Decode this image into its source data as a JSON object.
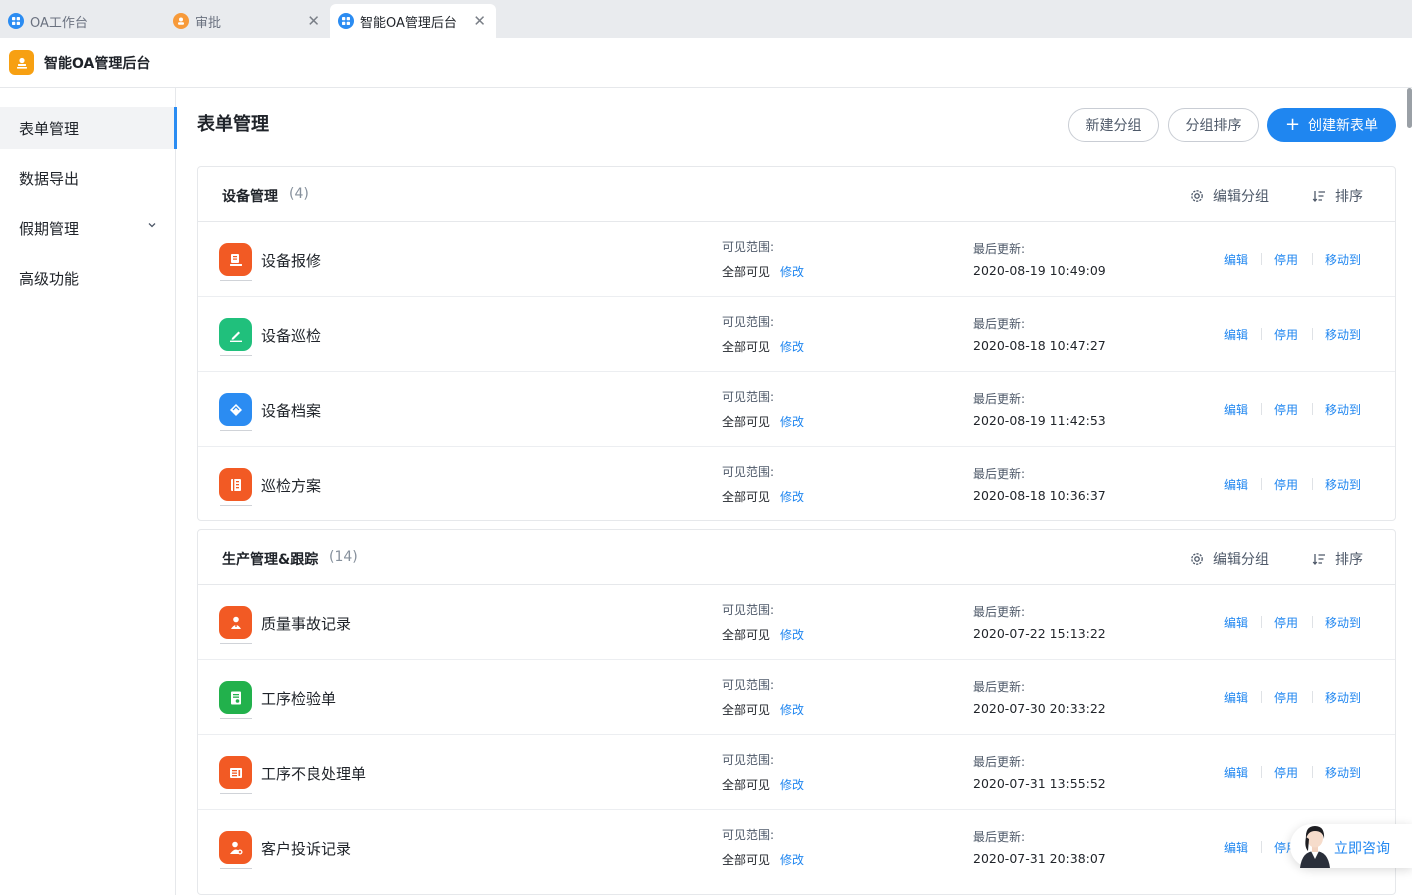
{
  "tabs": [
    {
      "label": "OA工作台",
      "icon": "apps-icon",
      "color": "#2b8cf2",
      "active": false,
      "closable": false
    },
    {
      "label": "审批",
      "icon": "user-icon",
      "color": "#f79a3a",
      "active": false,
      "closable": true
    },
    {
      "label": "智能OA管理后台",
      "icon": "apps-icon",
      "color": "#2b8cf2",
      "active": true,
      "closable": true
    }
  ],
  "tab_close_glyph": "✕",
  "app": {
    "title": "智能OA管理后台",
    "logo_color": "#f7a012"
  },
  "sidebar": {
    "items": [
      {
        "label": "表单管理",
        "active": true
      },
      {
        "label": "数据导出",
        "active": false
      },
      {
        "label": "假期管理",
        "active": false,
        "expandable": true
      },
      {
        "label": "高级功能",
        "active": false
      }
    ]
  },
  "page": {
    "title": "表单管理",
    "new_group_label": "新建分组",
    "sort_group_label": "分组排序",
    "create_form_plus": "+",
    "create_form_label": "创建新表单"
  },
  "labels": {
    "visible_range": "可见范围:",
    "last_updated": "最后更新:",
    "modify": "修改",
    "edit": "编辑",
    "disable": "停用",
    "move_to": "移动到",
    "edit_group": "编辑分组",
    "sort": "排序"
  },
  "groups": [
    {
      "name": "设备管理",
      "count": "(4)",
      "forms": [
        {
          "name": "设备报修",
          "visibility": "全部可见",
          "updated": "2020-08-19 10:49:09",
          "icon": "repair-icon",
          "color": "#f25a24"
        },
        {
          "name": "设备巡检",
          "visibility": "全部可见",
          "updated": "2020-08-18 10:47:27",
          "icon": "pen-icon",
          "color": "#20c07c"
        },
        {
          "name": "设备档案",
          "visibility": "全部可见",
          "updated": "2020-08-19 11:42:53",
          "icon": "archive-icon",
          "color": "#2b8cf2"
        },
        {
          "name": "巡检方案",
          "visibility": "全部可见",
          "updated": "2020-08-18 10:36:37",
          "icon": "plan-icon",
          "color": "#f25a24"
        }
      ]
    },
    {
      "name": "生产管理&跟踪",
      "count": "(14)",
      "forms": [
        {
          "name": "质量事故记录",
          "visibility": "全部可见",
          "updated": "2020-07-22 15:13:22",
          "icon": "person-alert-icon",
          "color": "#f25a24"
        },
        {
          "name": "工序检验单",
          "visibility": "全部可见",
          "updated": "2020-07-30 20:33:22",
          "icon": "document-check-icon",
          "color": "#22b14c"
        },
        {
          "name": "工序不良处理单",
          "visibility": "全部可见",
          "updated": "2020-07-31 13:55:52",
          "icon": "document-list-icon",
          "color": "#f25a24"
        },
        {
          "name": "客户投诉记录",
          "visibility": "全部可见",
          "updated": "2020-07-31 20:38:07",
          "icon": "user-complaint-icon",
          "color": "#f25a24"
        }
      ]
    }
  ],
  "consult": {
    "label": "立即咨询"
  },
  "colors": {
    "accent": "#1f86f0",
    "sidebar_active_bg": "#f2f3f5"
  }
}
